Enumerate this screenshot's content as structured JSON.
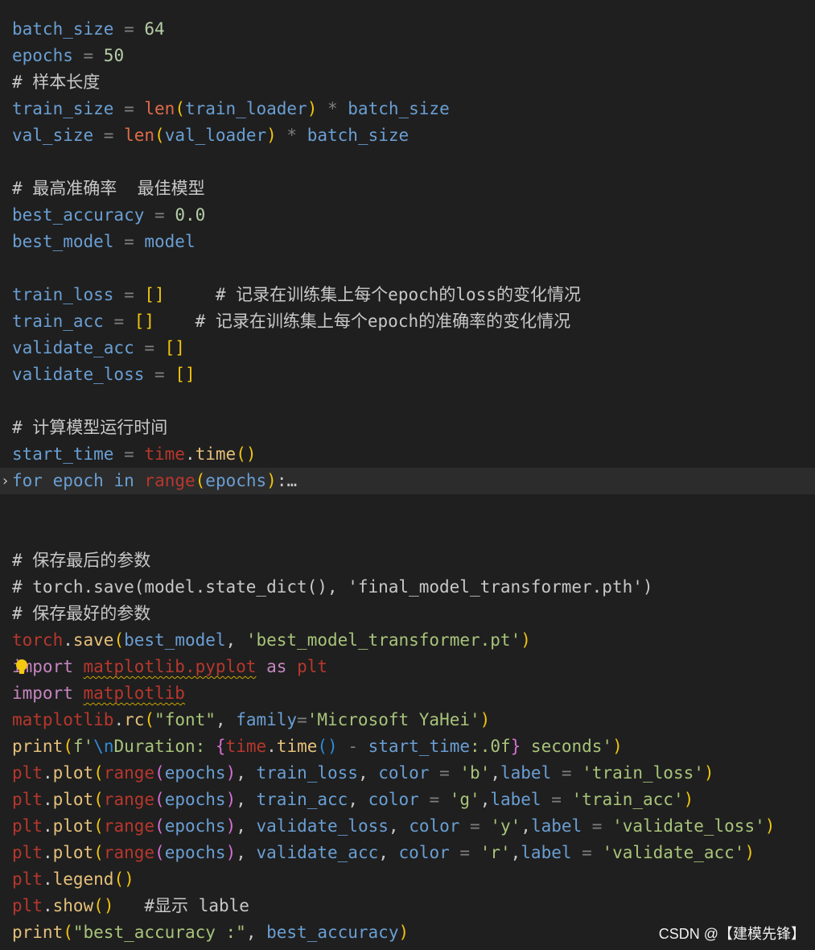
{
  "colors": {
    "background": "#1f1f1f",
    "line_highlight": "#2c2c2c",
    "default": "#c8c8c8",
    "variable": "#6a9fd4",
    "keyword": "#c586c0",
    "number": "#b5cea8",
    "function": "#e5c07b",
    "builtin": "#e06c4a",
    "error_red": "#b8372d",
    "string": "#a8c47a",
    "comment": "#c8c8c8",
    "bracket": "#f1c40f",
    "bracket_blue": "#2e8ad8",
    "bracket_pink": "#d670d6",
    "operator": "#7f7f7f"
  },
  "editor": {
    "lines": [
      {
        "tokens": [
          {
            "t": "batch_size",
            "c": "variable"
          },
          {
            "t": " = ",
            "c": "operator"
          },
          {
            "t": "64",
            "c": "number"
          }
        ]
      },
      {
        "tokens": [
          {
            "t": "epochs",
            "c": "variable"
          },
          {
            "t": " = ",
            "c": "operator"
          },
          {
            "t": "50",
            "c": "number"
          }
        ]
      },
      {
        "tokens": [
          {
            "t": "# 样本长度",
            "c": "comment"
          }
        ]
      },
      {
        "tokens": [
          {
            "t": "train_size",
            "c": "variable"
          },
          {
            "t": " = ",
            "c": "operator"
          },
          {
            "t": "len",
            "c": "builtin"
          },
          {
            "t": "(",
            "c": "bracket"
          },
          {
            "t": "train_loader",
            "c": "variable"
          },
          {
            "t": ")",
            "c": "bracket"
          },
          {
            "t": " * ",
            "c": "operator"
          },
          {
            "t": "batch_size",
            "c": "variable"
          }
        ]
      },
      {
        "tokens": [
          {
            "t": "val_size",
            "c": "variable"
          },
          {
            "t": " = ",
            "c": "operator"
          },
          {
            "t": "len",
            "c": "builtin"
          },
          {
            "t": "(",
            "c": "bracket"
          },
          {
            "t": "val_loader",
            "c": "variable"
          },
          {
            "t": ")",
            "c": "bracket"
          },
          {
            "t": " * ",
            "c": "operator"
          },
          {
            "t": "batch_size",
            "c": "variable"
          }
        ]
      },
      {
        "tokens": []
      },
      {
        "tokens": [
          {
            "t": "# 最高准确率  最佳模型",
            "c": "comment"
          }
        ]
      },
      {
        "tokens": [
          {
            "t": "best_accuracy",
            "c": "variable"
          },
          {
            "t": " = ",
            "c": "operator"
          },
          {
            "t": "0.0",
            "c": "number"
          }
        ]
      },
      {
        "tokens": [
          {
            "t": "best_model",
            "c": "variable"
          },
          {
            "t": " = ",
            "c": "operator"
          },
          {
            "t": "model",
            "c": "variable"
          }
        ]
      },
      {
        "tokens": []
      },
      {
        "tokens": [
          {
            "t": "train_loss",
            "c": "variable"
          },
          {
            "t": " = ",
            "c": "operator"
          },
          {
            "t": "[]",
            "c": "bracket"
          },
          {
            "t": "     ",
            "c": "default"
          },
          {
            "t": "# 记录在训练集上每个epoch的loss的变化情况",
            "c": "comment"
          }
        ]
      },
      {
        "tokens": [
          {
            "t": "train_acc",
            "c": "variable"
          },
          {
            "t": " = ",
            "c": "operator"
          },
          {
            "t": "[]",
            "c": "bracket"
          },
          {
            "t": "    ",
            "c": "default"
          },
          {
            "t": "# 记录在训练集上每个epoch的准确率的变化情况",
            "c": "comment"
          }
        ]
      },
      {
        "tokens": [
          {
            "t": "validate_acc",
            "c": "variable"
          },
          {
            "t": " = ",
            "c": "operator"
          },
          {
            "t": "[]",
            "c": "bracket"
          }
        ]
      },
      {
        "tokens": [
          {
            "t": "validate_loss",
            "c": "variable"
          },
          {
            "t": " = ",
            "c": "operator"
          },
          {
            "t": "[]",
            "c": "bracket"
          }
        ]
      },
      {
        "tokens": []
      },
      {
        "tokens": [
          {
            "t": "# 计算模型运行时间",
            "c": "comment"
          }
        ]
      },
      {
        "tokens": [
          {
            "t": "start_time",
            "c": "variable"
          },
          {
            "t": " = ",
            "c": "operator"
          },
          {
            "t": "time",
            "c": "error_red"
          },
          {
            "t": ".",
            "c": "default"
          },
          {
            "t": "time",
            "c": "function"
          },
          {
            "t": "()",
            "c": "bracket"
          }
        ]
      },
      {
        "highlight": true,
        "fold": "›",
        "tokens": [
          {
            "t": "for",
            "c": "variable"
          },
          {
            "t": " ",
            "c": "default"
          },
          {
            "t": "epoch",
            "c": "variable"
          },
          {
            "t": " ",
            "c": "default"
          },
          {
            "t": "in",
            "c": "variable"
          },
          {
            "t": " ",
            "c": "default"
          },
          {
            "t": "range",
            "c": "error_red"
          },
          {
            "t": "(",
            "c": "bracket"
          },
          {
            "t": "epochs",
            "c": "variable"
          },
          {
            "t": ")",
            "c": "bracket"
          },
          {
            "t": ":",
            "c": "default"
          },
          {
            "t": "…",
            "c": "default"
          }
        ]
      },
      {
        "tokens": []
      },
      {
        "tokens": []
      },
      {
        "tokens": [
          {
            "t": "# 保存最后的参数",
            "c": "comment"
          }
        ]
      },
      {
        "tokens": [
          {
            "t": "# torch.save(model.state_dict(), 'final_model_transformer.pth')",
            "c": "comment"
          }
        ]
      },
      {
        "tokens": [
          {
            "t": "# 保存最好的参数",
            "c": "comment"
          }
        ]
      },
      {
        "tokens": [
          {
            "t": "torch",
            "c": "error_red"
          },
          {
            "t": ".",
            "c": "default"
          },
          {
            "t": "save",
            "c": "function"
          },
          {
            "t": "(",
            "c": "bracket"
          },
          {
            "t": "best_model",
            "c": "variable"
          },
          {
            "t": ", ",
            "c": "default"
          },
          {
            "t": "'best_model_transformer.pt'",
            "c": "string"
          },
          {
            "t": ")",
            "c": "bracket"
          }
        ]
      },
      {
        "bulb": true,
        "tokens": [
          {
            "t": "import",
            "c": "keyword"
          },
          {
            "t": " ",
            "c": "default"
          },
          {
            "t": "matplotlib.pyplot",
            "c": "error_red",
            "squiggle": true
          },
          {
            "t": " ",
            "c": "default"
          },
          {
            "t": "as",
            "c": "keyword"
          },
          {
            "t": " ",
            "c": "default"
          },
          {
            "t": "plt",
            "c": "error_red"
          }
        ]
      },
      {
        "tokens": [
          {
            "t": "import",
            "c": "keyword"
          },
          {
            "t": " ",
            "c": "default"
          },
          {
            "t": "matplotlib",
            "c": "error_red",
            "squiggle": true
          }
        ]
      },
      {
        "tokens": [
          {
            "t": "matplotlib",
            "c": "error_red"
          },
          {
            "t": ".",
            "c": "default"
          },
          {
            "t": "rc",
            "c": "function"
          },
          {
            "t": "(",
            "c": "bracket"
          },
          {
            "t": "\"font\"",
            "c": "string"
          },
          {
            "t": ", ",
            "c": "default"
          },
          {
            "t": "family",
            "c": "variable"
          },
          {
            "t": "=",
            "c": "operator"
          },
          {
            "t": "'Microsoft YaHei'",
            "c": "string"
          },
          {
            "t": ")",
            "c": "bracket"
          }
        ]
      },
      {
        "tokens": [
          {
            "t": "print",
            "c": "function"
          },
          {
            "t": "(",
            "c": "bracket"
          },
          {
            "t": "f'",
            "c": "string"
          },
          {
            "t": "\\n",
            "c": "bracket_blue"
          },
          {
            "t": "Duration: ",
            "c": "string"
          },
          {
            "t": "{",
            "c": "bracket_pink"
          },
          {
            "t": "time",
            "c": "error_red"
          },
          {
            "t": ".",
            "c": "default"
          },
          {
            "t": "time",
            "c": "function"
          },
          {
            "t": "()",
            "c": "bracket_blue"
          },
          {
            "t": " - ",
            "c": "operator"
          },
          {
            "t": "start_time",
            "c": "variable"
          },
          {
            "t": ":.0f",
            "c": "string"
          },
          {
            "t": "}",
            "c": "bracket_pink"
          },
          {
            "t": " seconds'",
            "c": "string"
          },
          {
            "t": ")",
            "c": "bracket"
          }
        ]
      },
      {
        "tokens": [
          {
            "t": "plt",
            "c": "error_red"
          },
          {
            "t": ".",
            "c": "default"
          },
          {
            "t": "plot",
            "c": "function"
          },
          {
            "t": "(",
            "c": "bracket"
          },
          {
            "t": "range",
            "c": "error_red"
          },
          {
            "t": "(",
            "c": "bracket_pink"
          },
          {
            "t": "epochs",
            "c": "variable"
          },
          {
            "t": ")",
            "c": "bracket_pink"
          },
          {
            "t": ", ",
            "c": "default"
          },
          {
            "t": "train_loss",
            "c": "variable"
          },
          {
            "t": ", ",
            "c": "default"
          },
          {
            "t": "color",
            "c": "variable"
          },
          {
            "t": " = ",
            "c": "operator"
          },
          {
            "t": "'b'",
            "c": "string"
          },
          {
            "t": ",",
            "c": "default"
          },
          {
            "t": "label",
            "c": "variable"
          },
          {
            "t": " = ",
            "c": "operator"
          },
          {
            "t": "'train_loss'",
            "c": "string"
          },
          {
            "t": ")",
            "c": "bracket"
          }
        ]
      },
      {
        "tokens": [
          {
            "t": "plt",
            "c": "error_red"
          },
          {
            "t": ".",
            "c": "default"
          },
          {
            "t": "plot",
            "c": "function"
          },
          {
            "t": "(",
            "c": "bracket"
          },
          {
            "t": "range",
            "c": "error_red"
          },
          {
            "t": "(",
            "c": "bracket_pink"
          },
          {
            "t": "epochs",
            "c": "variable"
          },
          {
            "t": ")",
            "c": "bracket_pink"
          },
          {
            "t": ", ",
            "c": "default"
          },
          {
            "t": "train_acc",
            "c": "variable"
          },
          {
            "t": ", ",
            "c": "default"
          },
          {
            "t": "color",
            "c": "variable"
          },
          {
            "t": " = ",
            "c": "operator"
          },
          {
            "t": "'g'",
            "c": "string"
          },
          {
            "t": ",",
            "c": "default"
          },
          {
            "t": "label",
            "c": "variable"
          },
          {
            "t": " = ",
            "c": "operator"
          },
          {
            "t": "'train_acc'",
            "c": "string"
          },
          {
            "t": ")",
            "c": "bracket"
          }
        ]
      },
      {
        "tokens": [
          {
            "t": "plt",
            "c": "error_red"
          },
          {
            "t": ".",
            "c": "default"
          },
          {
            "t": "plot",
            "c": "function"
          },
          {
            "t": "(",
            "c": "bracket"
          },
          {
            "t": "range",
            "c": "error_red"
          },
          {
            "t": "(",
            "c": "bracket_pink"
          },
          {
            "t": "epochs",
            "c": "variable"
          },
          {
            "t": ")",
            "c": "bracket_pink"
          },
          {
            "t": ", ",
            "c": "default"
          },
          {
            "t": "validate_loss",
            "c": "variable"
          },
          {
            "t": ", ",
            "c": "default"
          },
          {
            "t": "color",
            "c": "variable"
          },
          {
            "t": " = ",
            "c": "operator"
          },
          {
            "t": "'y'",
            "c": "string"
          },
          {
            "t": ",",
            "c": "default"
          },
          {
            "t": "label",
            "c": "variable"
          },
          {
            "t": " = ",
            "c": "operator"
          },
          {
            "t": "'validate_loss'",
            "c": "string"
          },
          {
            "t": ")",
            "c": "bracket"
          }
        ]
      },
      {
        "tokens": [
          {
            "t": "plt",
            "c": "error_red"
          },
          {
            "t": ".",
            "c": "default"
          },
          {
            "t": "plot",
            "c": "function"
          },
          {
            "t": "(",
            "c": "bracket"
          },
          {
            "t": "range",
            "c": "error_red"
          },
          {
            "t": "(",
            "c": "bracket_pink"
          },
          {
            "t": "epochs",
            "c": "variable"
          },
          {
            "t": ")",
            "c": "bracket_pink"
          },
          {
            "t": ", ",
            "c": "default"
          },
          {
            "t": "validate_acc",
            "c": "variable"
          },
          {
            "t": ", ",
            "c": "default"
          },
          {
            "t": "color",
            "c": "variable"
          },
          {
            "t": " = ",
            "c": "operator"
          },
          {
            "t": "'r'",
            "c": "string"
          },
          {
            "t": ",",
            "c": "default"
          },
          {
            "t": "label",
            "c": "variable"
          },
          {
            "t": " = ",
            "c": "operator"
          },
          {
            "t": "'validate_acc'",
            "c": "string"
          },
          {
            "t": ")",
            "c": "bracket"
          }
        ]
      },
      {
        "tokens": [
          {
            "t": "plt",
            "c": "error_red"
          },
          {
            "t": ".",
            "c": "default"
          },
          {
            "t": "legend",
            "c": "function"
          },
          {
            "t": "()",
            "c": "bracket"
          }
        ]
      },
      {
        "tokens": [
          {
            "t": "plt",
            "c": "error_red"
          },
          {
            "t": ".",
            "c": "default"
          },
          {
            "t": "show",
            "c": "function"
          },
          {
            "t": "()",
            "c": "bracket"
          },
          {
            "t": "   ",
            "c": "default"
          },
          {
            "t": "#显示 lable",
            "c": "comment"
          }
        ]
      },
      {
        "tokens": [
          {
            "t": "print",
            "c": "function"
          },
          {
            "t": "(",
            "c": "bracket"
          },
          {
            "t": "\"best_accuracy :\"",
            "c": "string"
          },
          {
            "t": ", ",
            "c": "default"
          },
          {
            "t": "best_accuracy",
            "c": "variable"
          },
          {
            "t": ")",
            "c": "bracket"
          }
        ]
      }
    ]
  },
  "watermark": {
    "text": "CSDN @【建模先锋】"
  }
}
